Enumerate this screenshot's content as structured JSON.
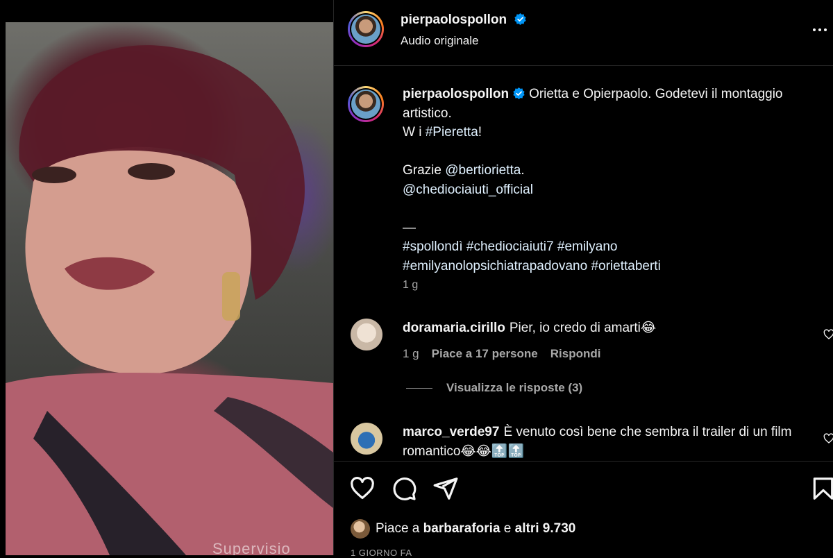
{
  "video": {
    "caption_fragment": "Supervisio"
  },
  "header": {
    "username": "pierpaolospollon",
    "audio": "Audio originale"
  },
  "post": {
    "username": "pierpaolospollon",
    "caption_line1": "Orietta e Opierpaolo. Godetevi il montaggio artistico.",
    "caption_w": "W i ",
    "caption_hashtag1": "#Pieretta",
    "caption_w_end": "!",
    "caption_thanks": "Grazie ",
    "caption_mention1": "@bertiorietta",
    "caption_dot": ".",
    "caption_mention2": "@chediociaiuti_official",
    "caption_dash": "—",
    "caption_hashtags": "#spollondì #chediociaiuti7 #emilyano #emilyanolopsichiatrapadovano #oriettaberti",
    "time": "1 g"
  },
  "comments": [
    {
      "username": "doramaria.cirillo",
      "text": "Pier, io credo di amarti😂",
      "time": "1 g",
      "likes": "Piace a 17 persone",
      "reply": "Rispondi",
      "view_replies": "Visualizza le risposte (3)"
    },
    {
      "username": "marco_verde97",
      "text": "È venuto così bene che sembra il trailer di un film romantico😂😂🔝🔝"
    }
  ],
  "actions": {
    "like_icon": "heart-icon",
    "comment_icon": "comment-icon",
    "share_icon": "share-icon",
    "save_icon": "bookmark-icon"
  },
  "likes": {
    "prefix": "Piace a ",
    "user": "barbaraforia",
    "middle": " e ",
    "others": "altri 9.730"
  },
  "timestamp": "1 GIORNO FA",
  "colors": {
    "background": "#000000",
    "text": "#f5f5f5",
    "muted": "#a8a8a8",
    "link": "#e0f1ff",
    "verified": "#0095f6",
    "divider": "#262626"
  }
}
